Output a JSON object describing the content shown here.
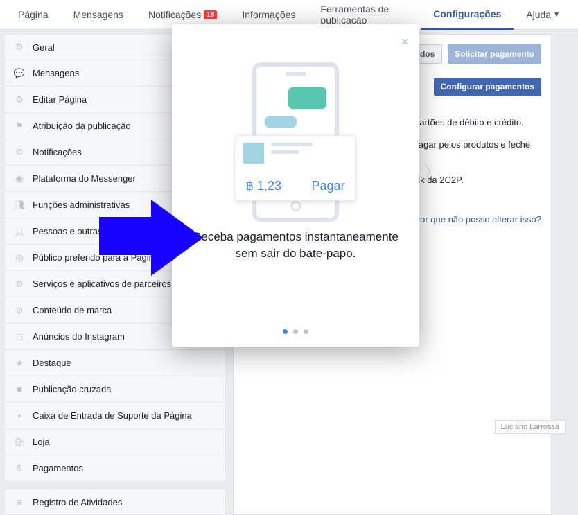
{
  "topnav": {
    "items": [
      "Página",
      "Mensagens",
      "Notificações",
      "Informações",
      "Ferramentas de publicação",
      "Configurações",
      "Ajuda"
    ],
    "notif_badge": "18",
    "active_index": 5
  },
  "sidebar": {
    "items": [
      {
        "label": "Geral",
        "icon": "gear"
      },
      {
        "label": "Mensagens",
        "icon": "chat"
      },
      {
        "label": "Editar Página",
        "icon": "gear"
      },
      {
        "label": "Atribuição da publicação",
        "icon": "flag"
      },
      {
        "label": "Notificações",
        "icon": "globe"
      },
      {
        "label": "Plataforma do Messenger",
        "icon": "msgr"
      },
      {
        "label": "Funções administrativas",
        "icon": "people"
      },
      {
        "label": "Pessoas e outras Páginas",
        "icon": "person"
      },
      {
        "label": "Público preferido para a Página",
        "icon": "target"
      },
      {
        "label": "Serviços e aplicativos de parceiros",
        "icon": "gear"
      },
      {
        "label": "Conteúdo de marca",
        "icon": "handshake"
      },
      {
        "label": "Anúncios do Instagram",
        "icon": "insta"
      },
      {
        "label": "Destaque",
        "icon": "star"
      },
      {
        "label": "Publicação cruzada",
        "icon": "video"
      },
      {
        "label": "Caixa de Entrada de Suporte da Página",
        "icon": "fb"
      },
      {
        "label": "Loja",
        "icon": "bag"
      },
      {
        "label": "Pagamentos",
        "icon": "money"
      }
    ],
    "activity_log": "Registro de Atividades"
  },
  "panel": {
    "ver_pedidos": "Ver pedidos",
    "solicitar": "Solicitar pagamento",
    "configurar": "Configurar pagamentos",
    "desc1": "Aceite pagamentos por processamento de cartões de débito e crédito.",
    "desc2": "Ofereça aos clientes uma forma rápida de pagar pelos produtos e feche vendas sem sair do Messenger.",
    "desc3": "Pagamentos processados pelo parceiro Qwik da 2C2P.",
    "link": "Por que não posso alterar isso?"
  },
  "modal": {
    "amount": "฿ 1,23",
    "pay": "Pagar",
    "title": "Receba pagamentos instantaneamente sem sair do bate-papo.",
    "active_dot": 0
  },
  "author": "Luciano Larrossa"
}
